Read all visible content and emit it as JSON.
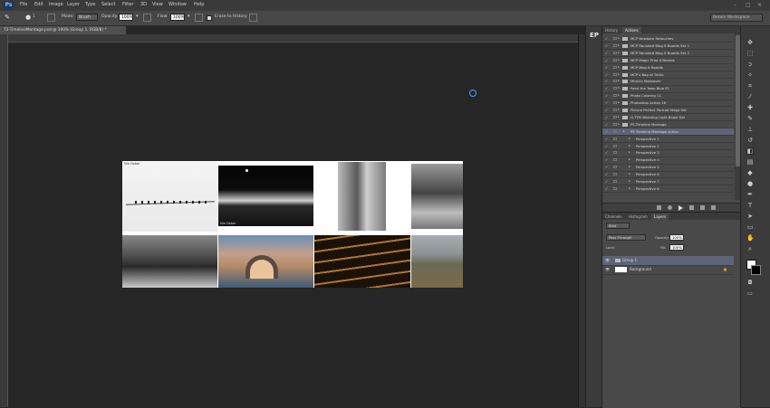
{
  "app": {
    "logo": "Ps"
  },
  "menu": [
    "File",
    "Edit",
    "Image",
    "Layer",
    "Type",
    "Select",
    "Filter",
    "3D",
    "View",
    "Window",
    "Help"
  ],
  "options": {
    "mode_label": "Mode:",
    "mode_value": "Brush",
    "opacity_label": "Opacity:",
    "opacity_value": "100%",
    "flow_label": "Flow:",
    "flow_value": "100%",
    "erase_history_label": "Erase to History",
    "brush_size": "1"
  },
  "workspace": {
    "value": "Retain Workspace"
  },
  "document": {
    "tab_title": "72-TimelineMontage.psd @ 100% (Group 1, RGB/8) *",
    "tile_label_1": "Nia Gabor",
    "tile_label_2": "Nia Gabor"
  },
  "panels": {
    "collapsed_label": "EP",
    "actions_tabs": [
      "History",
      "Actions"
    ],
    "actions": [
      {
        "label": "MCP Newborn Retouches",
        "type": "set"
      },
      {
        "label": "MCP Rounded Blog It Boards Set 1",
        "type": "set"
      },
      {
        "label": "MCP Rounded Blog It Boards Set 2",
        "type": "set"
      },
      {
        "label": "MCP Magic Print It Boards",
        "type": "set"
      },
      {
        "label": "MCP Blog It Boards",
        "type": "set"
      },
      {
        "label": "MCP's Bag of Tricks",
        "type": "set"
      },
      {
        "label": "Miracle Makeover",
        "type": "set"
      },
      {
        "label": "Paint the Town Blue P1",
        "type": "set"
      },
      {
        "label": "Photo Coloring 11",
        "type": "set"
      },
      {
        "label": "Photoshop Action 16",
        "type": "set"
      },
      {
        "label": "Picture Perfect Portrait Mega Set",
        "type": "set"
      },
      {
        "label": "G-TTM Warming Light Boost Set",
        "type": "set"
      },
      {
        "label": "PS-Timeline Montage",
        "type": "set"
      },
      {
        "label": "PS Timeline Montage Action",
        "type": "action",
        "selected": true
      },
      {
        "label": "Perspective 1",
        "type": "step"
      },
      {
        "label": "Perspective 2",
        "type": "step"
      },
      {
        "label": "Perspective 3",
        "type": "step"
      },
      {
        "label": "Perspective 4",
        "type": "step"
      },
      {
        "label": "Perspective 5",
        "type": "step"
      },
      {
        "label": "Perspective 6",
        "type": "step"
      },
      {
        "label": "Perspective 7",
        "type": "step"
      },
      {
        "label": "Perspective 8",
        "type": "step"
      }
    ],
    "layers_tabs": [
      "Channels",
      "Histogram",
      "Layers"
    ],
    "layers": {
      "kind_value": "Kind",
      "blend_value": "Pass Through",
      "opacity_label": "Opacity:",
      "opacity_value": "100%",
      "lock_label": "Lock:",
      "fill_label": "Fill:",
      "fill_value": "100%",
      "rows": [
        {
          "name": "Group 1",
          "selected": true
        },
        {
          "name": "Background",
          "selected": false
        }
      ]
    }
  },
  "colors": {
    "accent": "#49a3ff",
    "selection": "#5d6478"
  }
}
